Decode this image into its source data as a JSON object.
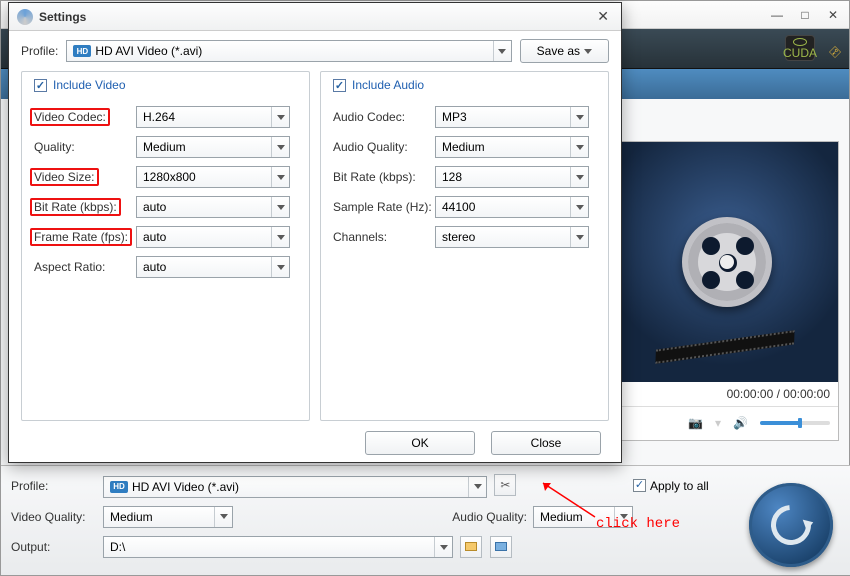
{
  "main": {
    "preview_time": "00:00:00 / 00:00:00",
    "profile_label": "Profile:",
    "profile_value": "HD AVI Video (*.avi)",
    "video_quality_label": "Video Quality:",
    "video_quality_value": "Medium",
    "audio_quality_label": "Audio Quality:",
    "audio_quality_value": "Medium",
    "output_label": "Output:",
    "output_value": "D:\\",
    "apply_all_label": "Apply to all",
    "cuda_label": "CUDA"
  },
  "dialog": {
    "title": "Settings",
    "profile_label": "Profile:",
    "profile_value": "HD AVI Video (*.avi)",
    "save_as": "Save as",
    "ok": "OK",
    "close": "Close",
    "video": {
      "include": "Include Video",
      "rows": [
        {
          "label": "Video Codec:",
          "value": "H.264",
          "hl": true
        },
        {
          "label": "Quality:",
          "value": "Medium",
          "hl": false
        },
        {
          "label": "Video Size:",
          "value": "1280x800",
          "hl": true
        },
        {
          "label": "Bit Rate (kbps):",
          "value": "auto",
          "hl": true
        },
        {
          "label": "Frame Rate (fps):",
          "value": "auto",
          "hl": true
        },
        {
          "label": "Aspect Ratio:",
          "value": "auto",
          "hl": false
        }
      ]
    },
    "audio": {
      "include": "Include Audio",
      "rows": [
        {
          "label": "Audio Codec:",
          "value": "MP3"
        },
        {
          "label": "Audio Quality:",
          "value": "Medium"
        },
        {
          "label": "Bit Rate (kbps):",
          "value": "128"
        },
        {
          "label": "Sample Rate (Hz):",
          "value": "44100"
        },
        {
          "label": "Channels:",
          "value": "stereo"
        }
      ]
    }
  },
  "annotation": {
    "text": "click here"
  }
}
